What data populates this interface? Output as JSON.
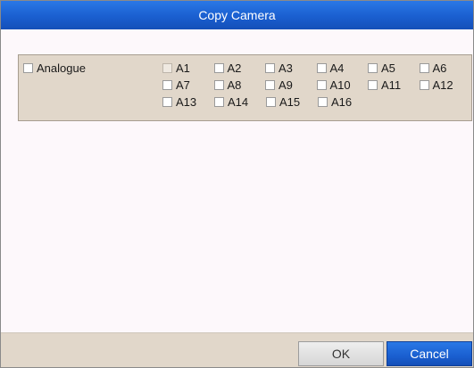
{
  "dialog": {
    "title": "Copy Camera"
  },
  "analogue": {
    "label": "Analogue",
    "checked": false
  },
  "cameras": [
    {
      "label": "A1",
      "checked": false,
      "disabled": true
    },
    {
      "label": "A2",
      "checked": false,
      "disabled": false
    },
    {
      "label": "A3",
      "checked": false,
      "disabled": false
    },
    {
      "label": "A4",
      "checked": false,
      "disabled": false
    },
    {
      "label": "A5",
      "checked": false,
      "disabled": false
    },
    {
      "label": "A6",
      "checked": false,
      "disabled": false
    },
    {
      "label": "A7",
      "checked": false,
      "disabled": false
    },
    {
      "label": "A8",
      "checked": false,
      "disabled": false
    },
    {
      "label": "A9",
      "checked": false,
      "disabled": false
    },
    {
      "label": "A10",
      "checked": false,
      "disabled": false
    },
    {
      "label": "A11",
      "checked": false,
      "disabled": false
    },
    {
      "label": "A12",
      "checked": false,
      "disabled": false
    },
    {
      "label": "A13",
      "checked": false,
      "disabled": false
    },
    {
      "label": "A14",
      "checked": false,
      "disabled": false
    },
    {
      "label": "A15",
      "checked": false,
      "disabled": false
    },
    {
      "label": "A16",
      "checked": false,
      "disabled": false
    }
  ],
  "footer": {
    "ok_label": "OK",
    "cancel_label": "Cancel"
  },
  "colors": {
    "title_bar": "#1a5fd0",
    "panel": "#e1d7ca",
    "cancel_button": "#1a5fd0"
  }
}
